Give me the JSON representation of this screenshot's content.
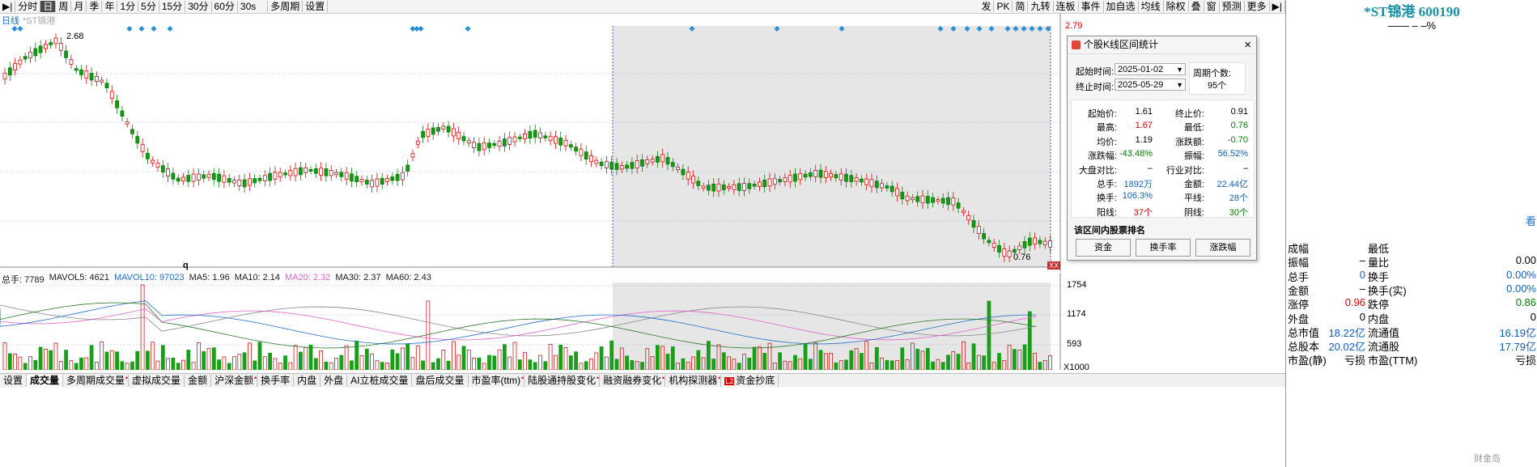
{
  "toolbar": {
    "left": [
      "分时",
      "日",
      "周",
      "月",
      "季",
      "年",
      "1分",
      "5分",
      "15分",
      "30分",
      "60分",
      "30s",
      "多周期",
      "设置"
    ],
    "active": "日",
    "right": [
      "发",
      "PK",
      "简",
      "九转",
      "连板",
      "事件",
      "加自选",
      "均线",
      "除权",
      "叠",
      "窗",
      "预测",
      "更多"
    ]
  },
  "chart": {
    "period_label": "日线",
    "stock_label": "*ST锦港",
    "high_label": "2.68",
    "low_label": "0.76",
    "price_right": "2.79",
    "q_marker": "q",
    "selection_badge": "XX"
  },
  "indicators": [
    {
      "text": "总手: 7789",
      "color": "#1a1a1a"
    },
    {
      "text": "MAVOL5: 4621",
      "color": "#1a1a1a"
    },
    {
      "text": "MAVOL10: 97023",
      "color": "#1f6fc6"
    },
    {
      "text": "MA5: 1.96",
      "color": "#1a1a1a"
    },
    {
      "text": "MA10: 2.14",
      "color": "#1a1a1a"
    },
    {
      "text": "MA20: 2.32",
      "color": "#e060d0"
    },
    {
      "text": "MA30: 2.37",
      "color": "#1a1a1a"
    },
    {
      "text": "MA60: 2.43",
      "color": "#1a1a1a"
    }
  ],
  "vol_axis": [
    "1754",
    "1174",
    "593",
    "X1000"
  ],
  "bottom_tabs": [
    {
      "label": "设置",
      "dot": false
    },
    {
      "label": "成交量",
      "dot": false,
      "active": true
    },
    {
      "label": "多周期成交量",
      "dot": true
    },
    {
      "label": "虚拟成交量",
      "dot": false
    },
    {
      "label": "金额",
      "dot": false
    },
    {
      "label": "沪深金额",
      "dot": true
    },
    {
      "label": "换手率",
      "dot": false
    },
    {
      "label": "内盘",
      "dot": false
    },
    {
      "label": "外盘",
      "dot": false
    },
    {
      "label": "AI立桩成交量",
      "dot": false
    },
    {
      "label": "盘后成交量",
      "dot": false
    },
    {
      "label": "市盈率(ttm)",
      "dot": true
    },
    {
      "label": "陆股通持股变化",
      "dot": true
    },
    {
      "label": "融资融券变化",
      "dot": true
    },
    {
      "label": "机构探测器",
      "dot": true
    },
    {
      "label": "资金抄底",
      "dot": false,
      "badge": "L2"
    }
  ],
  "right_panel": {
    "title": "*ST锦港 600190",
    "sub": "—— – –%",
    "cut_label": "看",
    "rows": [
      {
        "l1": "成幅",
        "v1": "",
        "l2": "最低",
        "v2": ""
      },
      {
        "l1": "振幅",
        "v1": "–",
        "l2": "量比",
        "v2": "0.00"
      },
      {
        "l1": "总手",
        "v1": "0",
        "l2": "换手",
        "v2": "0.00%"
      },
      {
        "l1": "金额",
        "v1": "–",
        "l2": "换手(实)",
        "v2": "0.00%"
      },
      {
        "l1": "涨停",
        "v1": "0.96",
        "l2": "跌停",
        "v2": "0.86"
      },
      {
        "l1": "外盘",
        "v1": "0",
        "l2": "内盘",
        "v2": "0"
      },
      {
        "l1": "总市值",
        "v1": "18.22亿",
        "l2": "流通值",
        "v2": "16.19亿"
      },
      {
        "l1": "总股本",
        "v1": "20.02亿",
        "l2": "流通股",
        "v2": "17.79亿"
      },
      {
        "l1": "市盈(静)",
        "v1": "亏损",
        "l2": "市盈(TTM)",
        "v2": "亏损"
      }
    ],
    "watermark": "财金岛"
  },
  "dialog": {
    "title": "个股K线区间统计",
    "start_label": "起始时间:",
    "start_value": "2025-01-02",
    "end_label": "终止时间:",
    "end_value": "2025-05-29",
    "period_count_label": "周期个数:",
    "period_count": "95个",
    "stats": [
      {
        "l1": "起始价:",
        "v1": "1.61",
        "c1": "#000",
        "l2": "终止价:",
        "v2": "0.91",
        "c2": "#000"
      },
      {
        "l1": "最高:",
        "v1": "1.67",
        "c1": "#d00000",
        "l2": "最低:",
        "v2": "0.76",
        "c2": "#008000"
      },
      {
        "l1": "均价:",
        "v1": "1.19",
        "c1": "#000",
        "l2": "涨跌额:",
        "v2": "-0.70",
        "c2": "#008000"
      },
      {
        "l1": "涨跌幅:",
        "v1": "-43.48%",
        "c1": "#008000",
        "l2": "振幅:",
        "v2": "56.52%",
        "c2": "#1060c0"
      },
      {
        "l1": "大盘对比:",
        "v1": "–",
        "c1": "#000",
        "l2": "行业对比:",
        "v2": "–",
        "c2": "#000"
      },
      {
        "l1": "总手:",
        "v1": "1892万",
        "c1": "#1060c0",
        "l2": "金额:",
        "v2": "22.44亿",
        "c2": "#1060c0"
      },
      {
        "l1": "换手:",
        "v1": "106.3%",
        "c1": "#1060c0",
        "l2": "平线:",
        "v2": "28个",
        "c2": "#1060c0"
      },
      {
        "l1": "阳线:",
        "v1": "37个",
        "c1": "#d00000",
        "l2": "阴线:",
        "v2": "30个",
        "c2": "#008000"
      }
    ],
    "section_label": "该区间内股票排名",
    "buttons": [
      "资金",
      "换手率",
      "涨跌幅"
    ]
  }
}
